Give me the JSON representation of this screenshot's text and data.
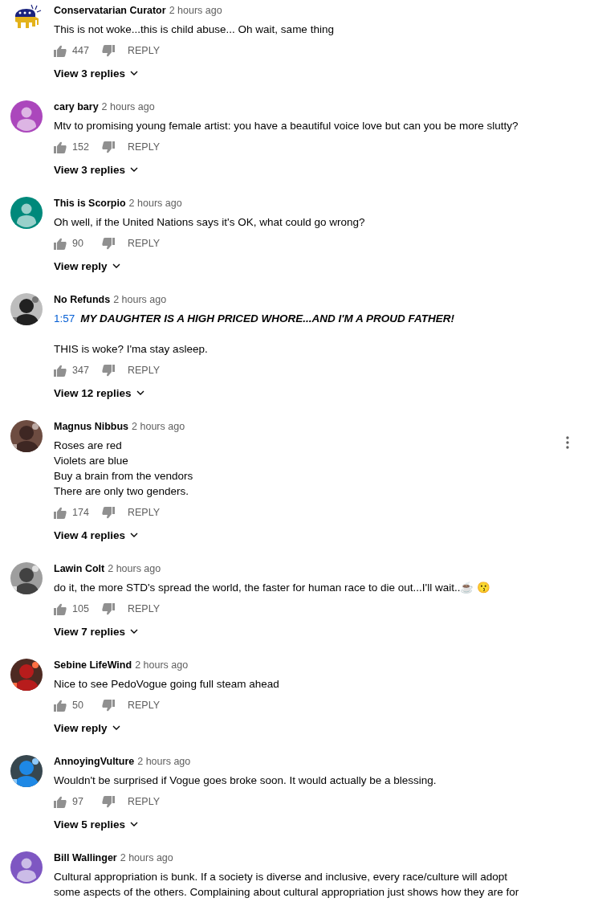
{
  "comments": [
    {
      "author": "Conservatarian Curator",
      "time": "2 hours ago",
      "avatar": {
        "kind": "elephant"
      },
      "text": "This is not woke...this is child abuse... Oh wait, same thing",
      "likes": "447",
      "reply": "REPLY",
      "replies": "View 3 replies",
      "menu": false
    },
    {
      "author": "cary bary",
      "time": "2 hours ago",
      "avatar": {
        "kind": "default",
        "color": "#ab47bc"
      },
      "text": "Mtv to promising young female artist: you have a beautiful voice love but can you be more slutty?",
      "likes": "152",
      "reply": "REPLY",
      "replies": "View 3 replies",
      "menu": false
    },
    {
      "author": "This is Scorpio",
      "time": "2 hours ago",
      "avatar": {
        "kind": "default",
        "color": "#00897b"
      },
      "text": "Oh well, if the United Nations says it's OK, what could go wrong?",
      "likes": "90",
      "reply": "REPLY",
      "replies": "View reply",
      "menu": false
    },
    {
      "author": "No Refunds",
      "time": "2 hours ago",
      "timestamp": "1:57",
      "quote": "MY DAUGHTER IS A HIGH PRICED WHORE...AND I'M A PROUD FATHER!",
      "text": "THIS is woke? I'ma stay asleep.",
      "likes": "347",
      "reply": "REPLY",
      "replies": "View 12 replies",
      "menu": false
    },
    {
      "author": "Magnus Nibbus",
      "time": "2 hours ago",
      "text": "Roses are red\nViolets are blue\nBuy a brain from the vendors\nThere are only two genders.",
      "likes": "174",
      "reply": "REPLY",
      "replies": "View 4 replies",
      "menu": true
    },
    {
      "author": "Lawin Colt",
      "time": "2 hours ago",
      "text": "do it, the more STD's spread the world, the faster for human race to die out...I'll wait..☕ 😗",
      "likes": "105",
      "reply": "REPLY",
      "replies": "View 7 replies",
      "menu": false
    },
    {
      "author": "Sebine LifeWind",
      "time": "2 hours ago",
      "text": "Nice to see PedoVogue going full steam ahead",
      "likes": "50",
      "reply": "REPLY",
      "replies": "View reply",
      "menu": false
    },
    {
      "author": "AnnoyingVulture",
      "time": "2 hours ago",
      "text": "Wouldn't be surprised if Vogue goes broke soon. It would actually be a blessing.",
      "likes": "97",
      "reply": "REPLY",
      "replies": "View 5 replies",
      "menu": false
    },
    {
      "author": "Bill Wallinger",
      "time": "2 hours ago",
      "avatar": {
        "kind": "default",
        "color": "#7e57c2"
      },
      "text": "Cultural appropriation is bunk. If a society is diverse and inclusive, every race/culture will adopt some aspects of the others. Complaining about cultural appropriation just shows how they are for",
      "menu": false
    }
  ]
}
